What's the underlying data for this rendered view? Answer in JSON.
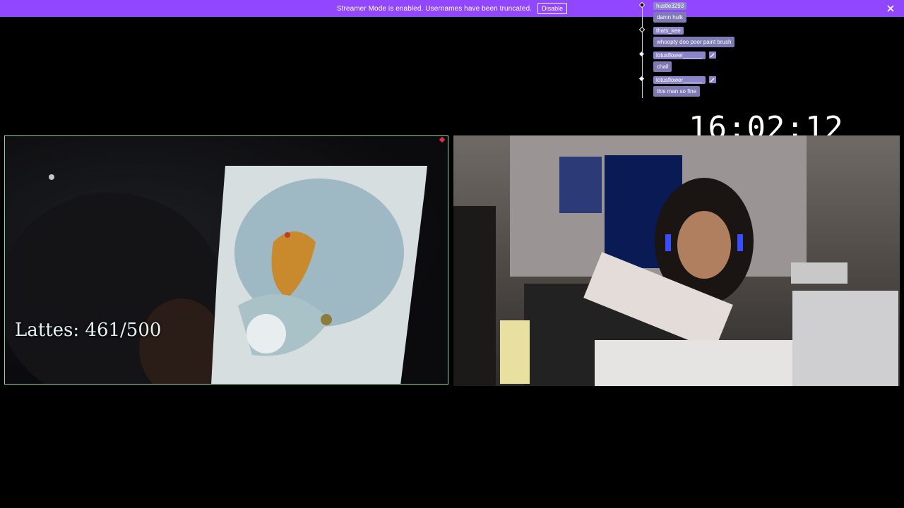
{
  "banner": {
    "message": "Streamer Mode is enabled. Usernames have been truncated.",
    "disable_label": "Disable",
    "color": "#9147ff"
  },
  "chat": {
    "messages": [
      {
        "user": "hustle3293",
        "text": "damn hulk",
        "has_badge": false
      },
      {
        "user": "thats_kee",
        "text": "whoopty doo poor paint brush",
        "has_badge": false
      },
      {
        "user": "lotusflower______",
        "text": "chail",
        "has_badge": true
      },
      {
        "user": "lotusflower______",
        "text": "this man so fine",
        "has_badge": true
      }
    ]
  },
  "clock": {
    "time": "16:02:12"
  },
  "left_cam": {
    "overlay_text": "Lattes: 461/500",
    "border_color": "#8fd3a6"
  },
  "right_cam": {}
}
